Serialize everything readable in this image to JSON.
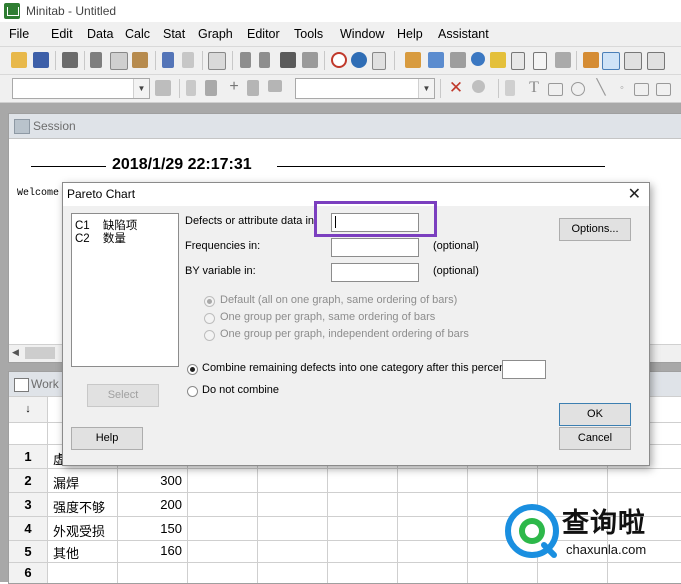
{
  "window": {
    "title": "Minitab - Untitled"
  },
  "menu": [
    "File",
    "Edit",
    "Data",
    "Calc",
    "Stat",
    "Graph",
    "Editor",
    "Tools",
    "Window",
    "Help",
    "Assistant"
  ],
  "session": {
    "title": "Session",
    "timestamp": "2018/1/29 22:17:31",
    "welcome": "Welcome"
  },
  "worksheet": {
    "title": "Work",
    "corner": "↓",
    "rows": [
      {
        "n": "1",
        "c1": "虚",
        "c2": ""
      },
      {
        "n": "2",
        "c1": "漏焊",
        "c2": "300"
      },
      {
        "n": "3",
        "c1": "强度不够",
        "c2": "200"
      },
      {
        "n": "4",
        "c1": "外观受损",
        "c2": "150"
      },
      {
        "n": "5",
        "c1": "其他",
        "c2": "160"
      },
      {
        "n": "6",
        "c1": "",
        "c2": ""
      }
    ]
  },
  "dialog": {
    "title": "Pareto Chart",
    "close": "✕",
    "columns": [
      {
        "id": "C1",
        "name": "缺陷项"
      },
      {
        "id": "C2",
        "name": "数量"
      }
    ],
    "defects_label": "Defects or attribute data in:",
    "frequencies_label": "Frequencies in:",
    "by_variable_label": "BY variable in:",
    "optional": "(optional)",
    "options_button": "Options...",
    "radio_default": "Default (all on one graph, same ordering of bars)",
    "radio_same": "One group per graph, same ordering of bars",
    "radio_independent": "One group per graph, independent ordering of bars",
    "combine_label": "Combine remaining defects into one category after this percent:",
    "no_combine_label": "Do not combine",
    "select_button": "Select",
    "help_button": "Help",
    "ok_button": "OK",
    "cancel_button": "Cancel"
  },
  "watermark": {
    "brand": "查询啦",
    "url": "chaxunla.com"
  },
  "colors": {
    "highlight": "#7b3fbf",
    "watermark_blue": "#1a8fe0"
  }
}
